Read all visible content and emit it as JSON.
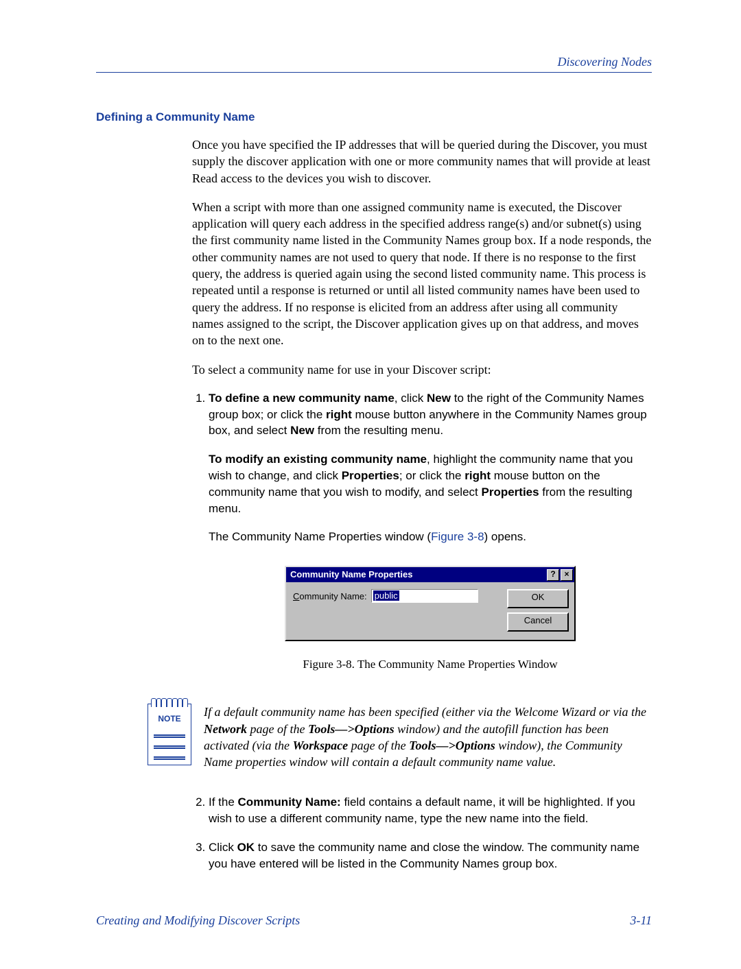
{
  "header": {
    "running_title": "Discovering Nodes"
  },
  "section": {
    "heading": "Defining a Community Name"
  },
  "paragraphs": {
    "intro": "Once you have specified the IP addresses that will be queried during the Discover, you must supply the discover application with one or more community names that will provide at least Read access to the devices you wish to discover.",
    "behavior": "When a script with more than one assigned community name is executed, the Discover application will query each address in the specified address range(s) and/or subnet(s) using the first community name listed in the Community Names group box. If a node responds, the other community names are not used to query that node. If there is no response to the first query, the address is queried again using the second listed community name. This process is repeated until a response is returned or until all listed community names have been used to query the address. If no response is elicited from an address after using all community names assigned to the script, the Discover application gives up on that address, and moves on to the next one.",
    "lead_in": "To select a community name for use in your Discover script:"
  },
  "step1_parts": {
    "pre": "To define a new community name",
    "mid1": ", click ",
    "new": "New",
    "mid2": " to the right of the Community Names group box; or click the ",
    "right": "right",
    "mid3": " mouse button anywhere in the Community Names group box, and select ",
    "mid4": " from the resulting menu."
  },
  "step1b_parts": {
    "pre": "To modify an existing community name",
    "mid1": ", highlight the community name that you wish to change, and click ",
    "props": "Properties",
    "mid2": "; or click the ",
    "right": "right",
    "mid3": " mouse button on the community name that you wish to modify, and select ",
    "mid4": " from the resulting menu."
  },
  "opens_line": {
    "pre": "The Community Name Properties window (",
    "link": "Figure 3-8",
    "post": ") opens."
  },
  "dialog": {
    "title": "Community Name Properties",
    "help": "?",
    "close": "×",
    "label_ul": "C",
    "label_rest": "ommunity Name:",
    "value": "public",
    "ok": "OK",
    "cancel": "Cancel"
  },
  "figure_caption": "Figure 3-8. The Community Name Properties Window",
  "note": {
    "label": "NOTE",
    "text_pre": "If a default community name has been specified (either via the Welcome Wizard or via the ",
    "nbold1": "Network",
    "mid1": " page of the ",
    "nbold2": "Tools—>Options",
    "mid2": " window) and the autofill function has been activated (via the ",
    "nbold3": "Workspace",
    "mid3": " page of the ",
    "nbold4": "Tools—>Options",
    "mid4": " window), the Community Name properties window will contain a default community name value."
  },
  "step2_parts": {
    "pre": "If the ",
    "bold": "Community Name:",
    "post": " field contains a default name, it will be highlighted. If you wish to use a different community name, type the new name into the field."
  },
  "step3_parts": {
    "pre": "Click ",
    "bold": "OK",
    "post": " to save the community name and close the window. The community name you have entered will be listed in the Community Names group box."
  },
  "footer": {
    "left": "Creating and Modifying Discover Scripts",
    "right": "3-11"
  }
}
